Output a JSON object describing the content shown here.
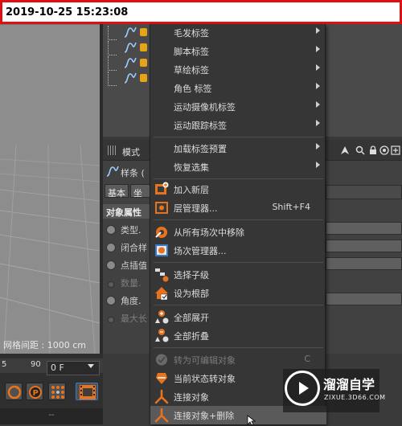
{
  "timestamp": "2019-10-25 15:23:08",
  "viewport": {
    "grid_label": "网格间距 : 1000 cm"
  },
  "attribute_manager": {
    "mode_label": "模式",
    "object_label": "样条 (",
    "tabs": [
      "基本",
      "坐标"
    ],
    "section_title": "对象属性",
    "properties": [
      {
        "label": "类型.",
        "disabled": false
      },
      {
        "label": "闭合样",
        "disabled": false
      },
      {
        "label": "点插值",
        "disabled": false
      },
      {
        "label": "数量.",
        "disabled": true
      },
      {
        "label": "角度.",
        "disabled": false
      },
      {
        "label": "最大长",
        "disabled": true
      }
    ]
  },
  "timeline": {
    "ruler_5": "5",
    "ruler_90": "90",
    "frame_field": "0 F",
    "bottom_text": "--"
  },
  "context_menu": {
    "items": [
      {
        "label": "毛发标签",
        "submenu": true
      },
      {
        "label": "脚本标签",
        "submenu": true
      },
      {
        "label": "草绘标签",
        "submenu": true
      },
      {
        "label": "角色 标签",
        "submenu": true
      },
      {
        "label": "运动摄像机标签",
        "submenu": true
      },
      {
        "label": "运动跟踪标签",
        "submenu": true
      },
      {
        "label": "加载标签预置",
        "submenu": true
      },
      {
        "label": "恢复选集",
        "submenu": true
      },
      {
        "label": "加入新层",
        "icon": "add-layer-icon"
      },
      {
        "label": "层管理器...",
        "shortcut": "Shift+F4",
        "icon": "layer-manager-icon"
      },
      {
        "label": "从所有场次中移除",
        "icon": "remove-takes-icon"
      },
      {
        "label": "场次管理器...",
        "icon": "take-manager-icon"
      },
      {
        "label": "选择子级",
        "icon": "select-children-icon"
      },
      {
        "label": "设为根部",
        "icon": "set-root-icon"
      },
      {
        "label": "全部展开",
        "icon": "expand-all-icon"
      },
      {
        "label": "全部折叠",
        "icon": "collapse-all-icon"
      },
      {
        "label": "转为可编辑对象",
        "shortcut": "C",
        "disabled": true,
        "icon": "make-editable-icon"
      },
      {
        "label": "当前状态转对象",
        "icon": "current-state-icon"
      },
      {
        "label": "连接对象",
        "icon": "connect-objects-icon"
      },
      {
        "label": "连接对象+删除",
        "icon": "connect-delete-icon",
        "highlighted": true
      }
    ]
  },
  "watermark": {
    "title": "溜溜自学",
    "url": "ZIXUE.3D66.COM"
  }
}
